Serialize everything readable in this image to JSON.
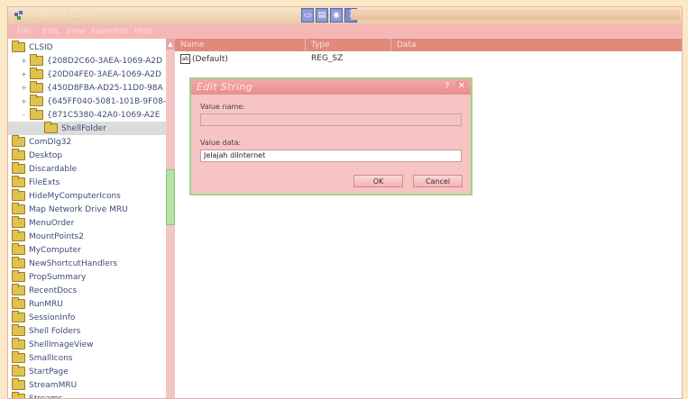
{
  "window": {
    "title": "Registry Editor",
    "toolbar_icons": [
      "window-icon",
      "tile-icon",
      "record-icon",
      "help-icon"
    ],
    "help_glyph": "?"
  },
  "menu": [
    "File",
    "Edit",
    "View",
    "Favorites",
    "Help"
  ],
  "tree": {
    "items": [
      {
        "label": "CLSID",
        "level": 0,
        "expander": ""
      },
      {
        "label": "{208D2C60-3AEA-1069-A2D",
        "level": 1,
        "expander": "+"
      },
      {
        "label": "{20D04FE0-3AEA-1069-A2D",
        "level": 1,
        "expander": "+"
      },
      {
        "label": "{450D8FBA-AD25-11D0-98A",
        "level": 1,
        "expander": "+"
      },
      {
        "label": "{645FF040-5081-101B-9F08-",
        "level": 1,
        "expander": "+"
      },
      {
        "label": "{871C5380-42A0-1069-A2E",
        "level": 1,
        "expander": "-"
      },
      {
        "label": "ShellFolder",
        "level": 2,
        "expander": ""
      },
      {
        "label": "ComDlg32",
        "level": 0,
        "expander": ""
      },
      {
        "label": "Desktop",
        "level": 0,
        "expander": ""
      },
      {
        "label": "Discardable",
        "level": 0,
        "expander": ""
      },
      {
        "label": "FileExts",
        "level": 0,
        "expander": ""
      },
      {
        "label": "HideMyComputerIcons",
        "level": 0,
        "expander": ""
      },
      {
        "label": "Map Network Drive MRU",
        "level": 0,
        "expander": ""
      },
      {
        "label": "MenuOrder",
        "level": 0,
        "expander": ""
      },
      {
        "label": "MountPoints2",
        "level": 0,
        "expander": ""
      },
      {
        "label": "MyComputer",
        "level": 0,
        "expander": ""
      },
      {
        "label": "NewShortcutHandlers",
        "level": 0,
        "expander": ""
      },
      {
        "label": "PropSummary",
        "level": 0,
        "expander": ""
      },
      {
        "label": "RecentDocs",
        "level": 0,
        "expander": ""
      },
      {
        "label": "RunMRU",
        "level": 0,
        "expander": ""
      },
      {
        "label": "SessionInfo",
        "level": 0,
        "expander": ""
      },
      {
        "label": "Shell Folders",
        "level": 0,
        "expander": ""
      },
      {
        "label": "ShellImageView",
        "level": 0,
        "expander": ""
      },
      {
        "label": "SmallIcons",
        "level": 0,
        "expander": ""
      },
      {
        "label": "StartPage",
        "level": 0,
        "expander": ""
      },
      {
        "label": "StreamMRU",
        "level": 0,
        "expander": ""
      },
      {
        "label": "Streams",
        "level": 0,
        "expander": ""
      }
    ]
  },
  "list": {
    "columns": [
      "Name",
      "Type",
      "Data"
    ],
    "rows": [
      {
        "name": "(Default)",
        "type": "REG_SZ",
        "data": ""
      }
    ]
  },
  "dialog": {
    "title": "Edit String",
    "value_name_label": "Value name:",
    "value_name": "",
    "value_data_label": "Value data:",
    "value_data": "Jelajah diInternet",
    "ok_label": "OK",
    "cancel_label": "Cancel",
    "help_glyph": "?",
    "close_glyph": "✕"
  },
  "colors": {
    "menubar": "#f5b7b6",
    "header": "#e08a7a",
    "dialog_bg": "#f7c4c4",
    "scroll_thumb": "#b8e3a6"
  }
}
